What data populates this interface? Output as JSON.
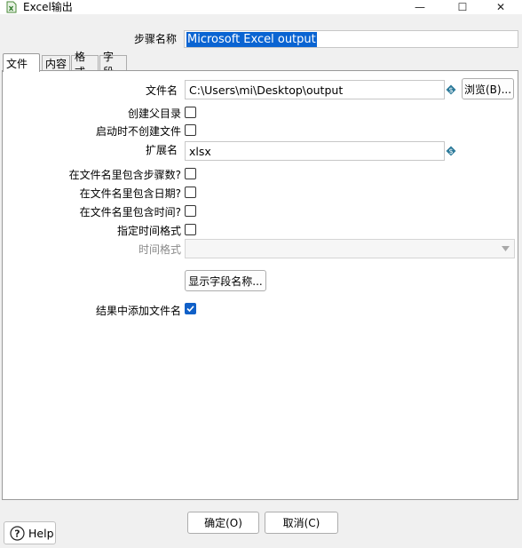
{
  "window": {
    "title": "Excel输出",
    "min_glyph": "—",
    "max_glyph": "☐",
    "close_glyph": "✕"
  },
  "step": {
    "label": "步骤名称",
    "value": "Microsoft Excel output"
  },
  "tabs": [
    {
      "label": "文件"
    },
    {
      "label": "内容"
    },
    {
      "label": "格式"
    },
    {
      "label": "字段"
    }
  ],
  "file": {
    "filename_label": "文件名",
    "filename_value": "C:\\Users\\mi\\Desktop\\output",
    "browse_label": "浏览(B)...",
    "create_parent_label": "创建父目录",
    "create_parent_checked": false,
    "no_create_on_start_label": "启动时不创建文件",
    "no_create_on_start_checked": false,
    "extension_label": "扩展名",
    "extension_value": "xlsx",
    "include_stepnr_label": "在文件名里包含步骤数?",
    "include_stepnr_checked": false,
    "include_date_label": "在文件名里包含日期?",
    "include_date_checked": false,
    "include_time_label": "在文件名里包含时间?",
    "include_time_checked": false,
    "specify_format_label": "指定时间格式",
    "specify_format_checked": false,
    "time_format_label": "时间格式",
    "time_format_value": "",
    "show_fields_label": "显示字段名称...",
    "add_filename_label": "结果中添加文件名",
    "add_filename_checked": true
  },
  "footer": {
    "ok_label": "确定(O)",
    "cancel_label": "取消(C)",
    "help_label": "Help"
  },
  "colors": {
    "accent": "#1060c8",
    "selection": "#0a64d2",
    "variable_icon": "#2c7a9a"
  }
}
